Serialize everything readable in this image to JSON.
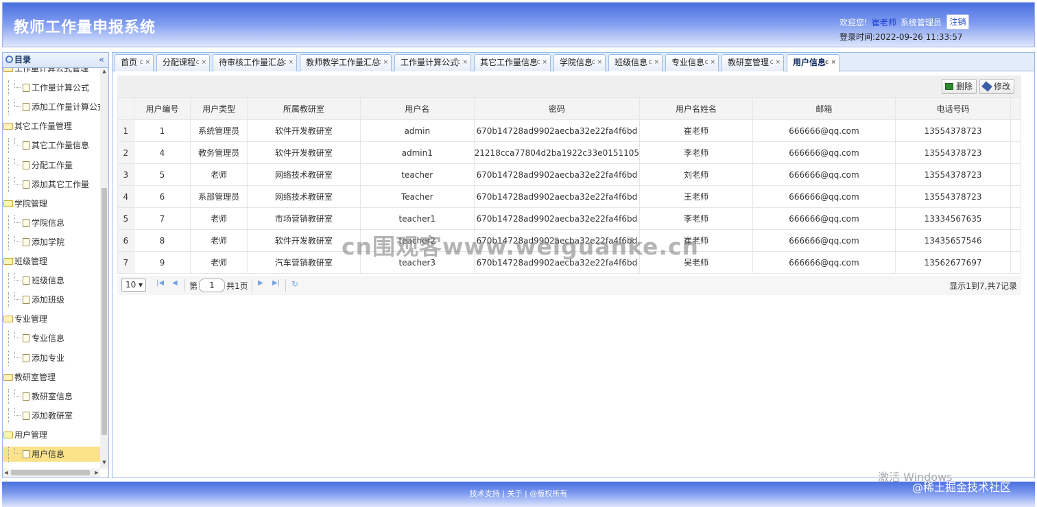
{
  "header": {
    "title": "教师工作量申报系统",
    "welcome": "欢迎您!",
    "user_name": "崔老师",
    "role": "系统管理员",
    "logout": "注销",
    "login_time": "登录时间:2022-09-26 11:33:57"
  },
  "sidebar": {
    "title": "目录",
    "nodes": [
      {
        "label": "工作量计算公式管理",
        "type": "folder"
      },
      {
        "label": "工作量计算公式",
        "type": "leaf"
      },
      {
        "label": "添加工作量计算公式",
        "type": "leaf"
      },
      {
        "label": "其它工作量管理",
        "type": "folder"
      },
      {
        "label": "其它工作量信息",
        "type": "leaf"
      },
      {
        "label": "分配工作量",
        "type": "leaf"
      },
      {
        "label": "添加其它工作量",
        "type": "leaf"
      },
      {
        "label": "学院管理",
        "type": "folder"
      },
      {
        "label": "学院信息",
        "type": "leaf"
      },
      {
        "label": "添加学院",
        "type": "leaf"
      },
      {
        "label": "班级管理",
        "type": "folder"
      },
      {
        "label": "班级信息",
        "type": "leaf"
      },
      {
        "label": "添加班级",
        "type": "leaf"
      },
      {
        "label": "专业管理",
        "type": "folder"
      },
      {
        "label": "专业信息",
        "type": "leaf"
      },
      {
        "label": "添加专业",
        "type": "leaf"
      },
      {
        "label": "教研室管理",
        "type": "folder"
      },
      {
        "label": "教研室信息",
        "type": "leaf"
      },
      {
        "label": "添加教研室",
        "type": "leaf"
      },
      {
        "label": "用户管理",
        "type": "folder"
      },
      {
        "label": "用户信息",
        "type": "leaf",
        "selected": true
      }
    ]
  },
  "tabs": [
    {
      "label": "首页"
    },
    {
      "label": "分配课程"
    },
    {
      "label": "待审核工作量汇总"
    },
    {
      "label": "教师教学工作量汇总"
    },
    {
      "label": "工作量计算公式"
    },
    {
      "label": "其它工作量信息"
    },
    {
      "label": "学院信息"
    },
    {
      "label": "班级信息"
    },
    {
      "label": "专业信息"
    },
    {
      "label": "教研室管理"
    },
    {
      "label": "用户信息",
      "active": true
    }
  ],
  "tab_tools": "c ×",
  "toolbar": {
    "delete": "删除",
    "edit": "修改"
  },
  "table": {
    "columns": [
      "用户编号",
      "用户类型",
      "所属教研室",
      "用户名",
      "密码",
      "用户名姓名",
      "邮箱",
      "电话号码"
    ],
    "rows": [
      [
        "1",
        "1",
        "系统管理员",
        "软件开发教研室",
        "admin",
        "670b14728ad9902aecba32e22fa4f6bd",
        "崔老师",
        "666666@qq.com",
        "13554378723"
      ],
      [
        "2",
        "4",
        "教务管理员",
        "软件开发教研室",
        "admin1",
        "21218cca77804d2ba1922c33e0151105",
        "李老师",
        "666666@qq.com",
        "13554378723"
      ],
      [
        "3",
        "5",
        "老师",
        "网络技术教研室",
        "teacher",
        "670b14728ad9902aecba32e22fa4f6bd",
        "刘老师",
        "666666@qq.com",
        "13554378723"
      ],
      [
        "4",
        "6",
        "系部管理员",
        "网络技术教研室",
        "Teacher",
        "670b14728ad9902aecba32e22fa4f6bd",
        "王老师",
        "666666@qq.com",
        "13554378723"
      ],
      [
        "5",
        "7",
        "老师",
        "市场营销教研室",
        "teacher1",
        "670b14728ad9902aecba32e22fa4f6bd",
        "李老师",
        "666666@qq.com",
        "13334567635"
      ],
      [
        "6",
        "8",
        "老师",
        "软件开发教研室",
        "teacher2",
        "670b14728ad9902aecba32e22fa4f6bd",
        "崔老师",
        "666666@qq.com",
        "13435657546"
      ],
      [
        "7",
        "9",
        "老师",
        "汽车营销教研室",
        "teacher3",
        "670b14728ad9902aecba32e22fa4f6bd",
        "吴老师",
        "666666@qq.com",
        "13562677697"
      ]
    ]
  },
  "pager": {
    "page_size": "10",
    "page_prefix": "第",
    "page_value": "1",
    "page_total": "共1页",
    "display": "显示1到7,共7记录"
  },
  "footer": {
    "text": "技术支持 | 关于 | @版权所有"
  },
  "watermarks": {
    "center": "cn围观客www.weiguanke.cn",
    "windows": "激活 Windows",
    "juejin": "@稀土掘金技术社区"
  }
}
